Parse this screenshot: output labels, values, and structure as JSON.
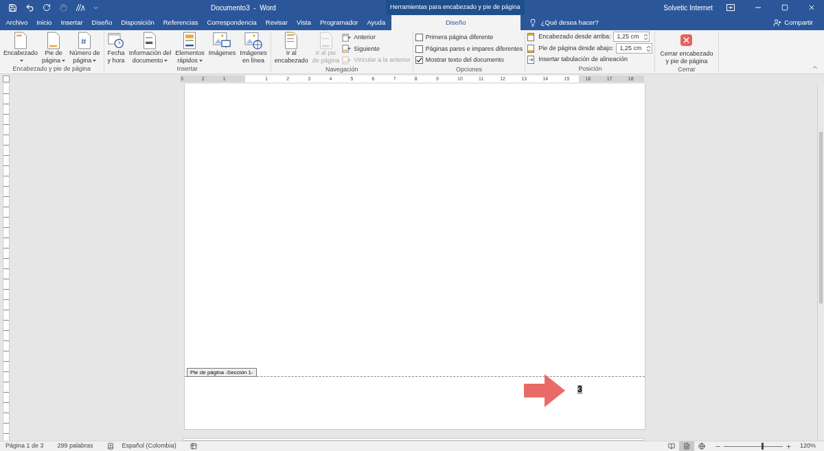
{
  "window": {
    "title": "Documento3  -  Word",
    "context_title": "Herramientas para encabezado y pie de página",
    "user": "Solvetic Internet"
  },
  "tabs": [
    {
      "label": "Archivo",
      "selected": false
    },
    {
      "label": "Inicio",
      "selected": false
    },
    {
      "label": "Insertar",
      "selected": false
    },
    {
      "label": "Diseño",
      "selected": false
    },
    {
      "label": "Disposición",
      "selected": false
    },
    {
      "label": "Referencias",
      "selected": false
    },
    {
      "label": "Correspondencia",
      "selected": false
    },
    {
      "label": "Revisar",
      "selected": false
    },
    {
      "label": "Vista",
      "selected": false
    },
    {
      "label": "Programador",
      "selected": false
    },
    {
      "label": "Ayuda",
      "selected": false
    },
    {
      "label": "Diseño",
      "selected": true
    }
  ],
  "tell_me": "¿Qué desea hacer?",
  "share": "Compartir",
  "ribbon": [
    {
      "label": "Encabezado y pie de página",
      "items": [
        {
          "kind": "large",
          "lines": [
            "Encabezado"
          ],
          "dropdown": true,
          "disabled": false
        },
        {
          "kind": "large",
          "lines": [
            "Pie de",
            "página"
          ],
          "dropdown": true,
          "disabled": false
        },
        {
          "kind": "large",
          "lines": [
            "Número de",
            "página"
          ],
          "dropdown": true,
          "disabled": false
        }
      ]
    },
    {
      "label": "Insertar",
      "items": [
        {
          "kind": "large",
          "lines": [
            "Fecha",
            "y hora"
          ],
          "dropdown": false,
          "disabled": false
        },
        {
          "kind": "large",
          "lines": [
            "Información del",
            "documento"
          ],
          "dropdown": true,
          "disabled": false
        },
        {
          "kind": "large",
          "lines": [
            "Elementos",
            "rápidos"
          ],
          "dropdown": true,
          "disabled": false
        },
        {
          "kind": "large",
          "lines": [
            "Imágenes"
          ],
          "dropdown": false,
          "disabled": false
        },
        {
          "kind": "large",
          "lines": [
            "Imágenes",
            "en línea"
          ],
          "dropdown": false,
          "disabled": false
        }
      ]
    },
    {
      "label": "Navegación",
      "items": [
        {
          "kind": "large",
          "lines": [
            "Ir al",
            "encabezado"
          ],
          "dropdown": false,
          "disabled": false
        },
        {
          "kind": "large",
          "lines": [
            "Ir al pie",
            "de página"
          ],
          "dropdown": false,
          "disabled": true
        },
        {
          "kind": "stack",
          "rows": [
            {
              "label": "Anterior",
              "disabled": false
            },
            {
              "label": "Siguiente",
              "disabled": false
            },
            {
              "label": "Vincular a la anterior",
              "disabled": true
            }
          ]
        }
      ]
    },
    {
      "label": "Opciones",
      "items": [
        {
          "kind": "checks",
          "rows": [
            {
              "label": "Primera página diferente",
              "checked": false
            },
            {
              "label": "Páginas pares e impares diferentes",
              "checked": false
            },
            {
              "label": "Mostrar texto del documento",
              "checked": true
            }
          ]
        }
      ]
    },
    {
      "label": "Posición",
      "items": [
        {
          "kind": "position",
          "rows": [
            {
              "label": "Encabezado desde arriba:",
              "value": "1,25 cm"
            },
            {
              "label": "Pie de página desde abajo:",
              "value": "1,25 cm"
            }
          ],
          "link": "Insertar tabulación de alineación"
        }
      ]
    },
    {
      "label": "Cerrar",
      "items": [
        {
          "kind": "close",
          "lines": [
            "Cerrar encabezado",
            "y pie de página"
          ]
        }
      ]
    }
  ],
  "ruler": {
    "labels": [
      "3",
      "2",
      "1",
      "1",
      "2",
      "3",
      "4",
      "5",
      "6",
      "7",
      "8",
      "9",
      "10",
      "11",
      "12",
      "13",
      "14",
      "15",
      "16",
      "17",
      "18"
    ]
  },
  "document": {
    "footer_tab": "Pie de página -Sección 1-",
    "page_number": "3"
  },
  "status_bar": {
    "page": "Página 1 de 3",
    "words": "299 palabras",
    "language": "Español (Colombia)",
    "zoom": "120%",
    "zoom_slider": {
      "level": 0.65
    },
    "views": [
      {
        "selected": false
      },
      {
        "selected": true
      },
      {
        "selected": false
      }
    ]
  }
}
